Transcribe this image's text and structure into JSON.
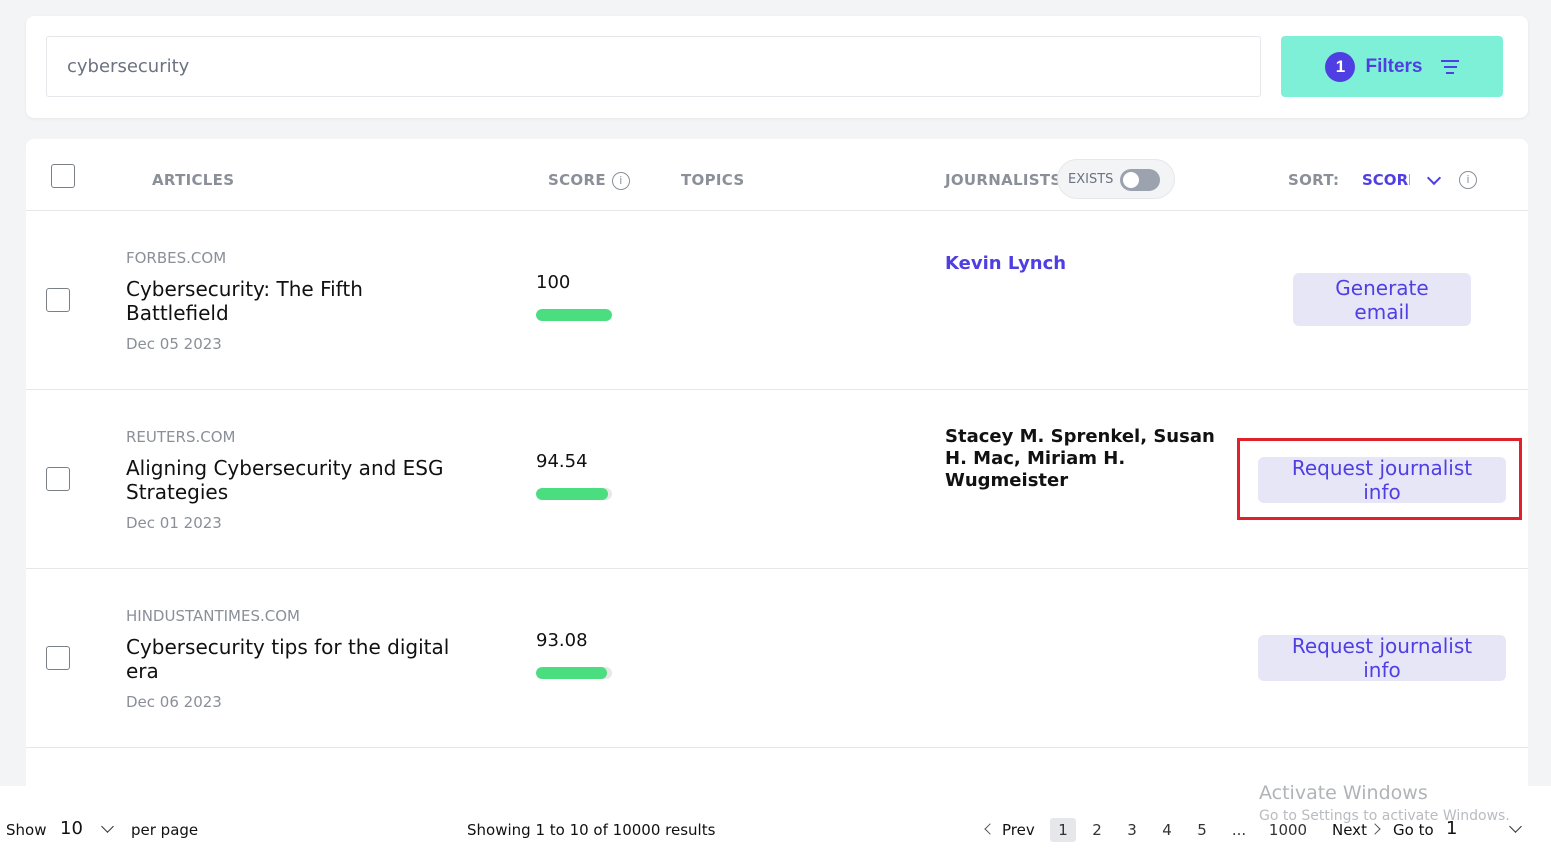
{
  "search": {
    "value": "cybersecurity"
  },
  "filters": {
    "count": "1",
    "label": "Filters"
  },
  "table": {
    "headers": {
      "articles": "ARTICLES",
      "score": "SCORE",
      "topics": "TOPICS",
      "journalists": "JOURNALISTS",
      "exists": "EXISTS",
      "sort_label": "SORT:",
      "sort_value": "SCORE"
    },
    "rows": [
      {
        "source": "FORBES.COM",
        "title": "Cybersecurity: The Fifth Battlefield",
        "date": "Dec 05 2023",
        "score": "100",
        "score_pct": 100,
        "journalist": "Kevin Lynch",
        "action": "Generate email"
      },
      {
        "source": "REUTERS.COM",
        "title": "Aligning Cybersecurity and ESG Strategies",
        "date": "Dec 01 2023",
        "score": "94.54",
        "score_pct": 94.54,
        "journalist": "Stacey M. Sprenkel, Susan H. Mac, Miriam H. Wugmeister",
        "action": "Request journalist info"
      },
      {
        "source": "HINDUSTANTIMES.COM",
        "title": "Cybersecurity tips for the digital era",
        "date": "Dec 06 2023",
        "score": "93.08",
        "score_pct": 93.08,
        "journalist": "",
        "action": "Request journalist info"
      }
    ]
  },
  "footer": {
    "show": "Show",
    "per_page_value": "10",
    "per_page": "per page",
    "showing": "Showing 1 to 10 of 10000 results",
    "prev": "Prev",
    "pages": [
      "1",
      "2",
      "3",
      "4",
      "5",
      "...",
      "1000"
    ],
    "next": "Next",
    "goto": "Go to",
    "goto_value": "1"
  },
  "watermark": {
    "line1": "Activate Windows",
    "line2": "Go to Settings to activate Windows."
  },
  "colors": {
    "accent": "#4f3fe3",
    "filters_bg": "#7ef0d8",
    "score_bar": "#4ade80",
    "highlight": "#e0202a"
  }
}
